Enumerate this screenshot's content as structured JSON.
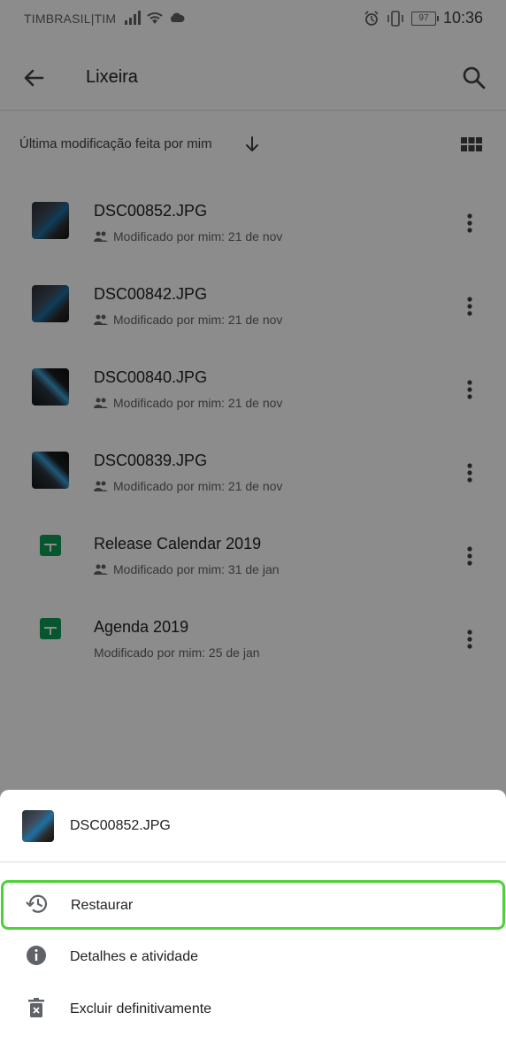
{
  "status_bar": {
    "carrier": "TIMBRASIL|TIM",
    "battery": "97",
    "time": "10:36"
  },
  "top_bar": {
    "title": "Lixeira"
  },
  "sort": {
    "label": "Última modificação feita por mim"
  },
  "files": [
    {
      "name": "DSC00852.JPG",
      "meta": "Modificado por mim: 21 de nov",
      "type": "photo",
      "shared": true
    },
    {
      "name": "DSC00842.JPG",
      "meta": "Modificado por mim: 21 de nov",
      "type": "photo",
      "shared": true
    },
    {
      "name": "DSC00840.JPG",
      "meta": "Modificado por mim: 21 de nov",
      "type": "photo",
      "shared": true
    },
    {
      "name": "DSC00839.JPG",
      "meta": "Modificado por mim: 21 de nov",
      "type": "photo",
      "shared": true
    },
    {
      "name": "Release Calendar 2019",
      "meta": "Modificado por mim: 31 de jan",
      "type": "sheet",
      "shared": true
    },
    {
      "name": "Agenda 2019",
      "meta": "Modificado por mim: 25 de jan",
      "type": "sheet",
      "shared": false
    }
  ],
  "bottom_sheet": {
    "title": "DSC00852.JPG",
    "actions": [
      {
        "label": "Restaurar",
        "icon": "restore-icon"
      },
      {
        "label": "Detalhes e atividade",
        "icon": "info-icon"
      },
      {
        "label": "Excluir definitivamente",
        "icon": "delete-forever-icon"
      }
    ]
  },
  "colors": {
    "highlight": "#4cd137",
    "sheets_green": "#0f9d58"
  }
}
